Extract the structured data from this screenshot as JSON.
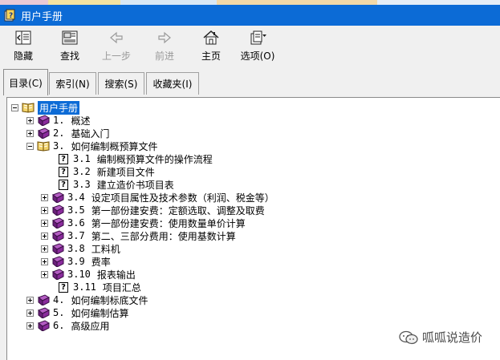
{
  "window": {
    "title": "用户手册"
  },
  "toolbar": {
    "buttons": [
      {
        "label": "隐藏",
        "icon": "hide-icon",
        "enabled": true
      },
      {
        "label": "查找",
        "icon": "find-icon",
        "enabled": true
      },
      {
        "label": "上一步",
        "icon": "back-arrow-icon",
        "enabled": false
      },
      {
        "label": "前进",
        "icon": "forward-arrow-icon",
        "enabled": false
      },
      {
        "label": "主页",
        "icon": "home-icon",
        "enabled": true
      },
      {
        "label": "选项(O)",
        "icon": "options-icon",
        "enabled": true
      }
    ]
  },
  "tabs": [
    {
      "label": "目录(C)",
      "active": true
    },
    {
      "label": "索引(N)",
      "active": false
    },
    {
      "label": "搜索(S)",
      "active": false
    },
    {
      "label": "收藏夹(I)",
      "active": false
    }
  ],
  "tree": {
    "root": {
      "label": "用户手册",
      "icon": "open-book-icon",
      "expanded": true,
      "selected": true
    },
    "items": [
      {
        "num": "1.",
        "label": "概述",
        "expander": "plus",
        "icon": "book-icon"
      },
      {
        "num": "2.",
        "label": "基础入门",
        "expander": "plus",
        "icon": "book-icon"
      },
      {
        "num": "3.",
        "label": "如何编制概预算文件",
        "expander": "minus",
        "icon": "open-book-icon",
        "children": [
          {
            "num": "3.1",
            "label": "编制概预算文件的操作流程",
            "expander": "none",
            "icon": "help-page-icon"
          },
          {
            "num": "3.2",
            "label": "新建项目文件",
            "expander": "none",
            "icon": "help-page-icon"
          },
          {
            "num": "3.3",
            "label": "建立造价书项目表",
            "expander": "none",
            "icon": "help-page-icon"
          },
          {
            "num": "3.4",
            "label": "设定项目属性及技术参数（利润、税金等）",
            "expander": "plus",
            "icon": "book-icon"
          },
          {
            "num": "3.5",
            "label": "第一部份建安费：定额选取、调整及取费",
            "expander": "plus",
            "icon": "book-icon"
          },
          {
            "num": "3.6",
            "label": "第一部份建安费：使用数量单价计算",
            "expander": "plus",
            "icon": "book-icon"
          },
          {
            "num": "3.7",
            "label": "第二、三部分费用：使用基数计算",
            "expander": "plus",
            "icon": "book-icon"
          },
          {
            "num": "3.8",
            "label": "工料机",
            "expander": "plus",
            "icon": "book-icon"
          },
          {
            "num": "3.9",
            "label": "费率",
            "expander": "plus",
            "icon": "book-icon"
          },
          {
            "num": "3.10",
            "label": "报表输出",
            "expander": "plus",
            "icon": "book-icon"
          },
          {
            "num": "3.11",
            "label": "项目汇总",
            "expander": "none",
            "icon": "help-page-icon"
          }
        ]
      },
      {
        "num": "4.",
        "label": "如何编制标底文件",
        "expander": "plus",
        "icon": "book-icon"
      },
      {
        "num": "5.",
        "label": "如何编制估算",
        "expander": "plus",
        "icon": "book-icon"
      },
      {
        "num": "6.",
        "label": "高级应用",
        "expander": "plus",
        "icon": "book-icon"
      }
    ]
  },
  "watermark": {
    "text": "呱呱说造价",
    "icon": "wechat-icon"
  },
  "colors": {
    "titlebar": "#0c6bd6",
    "selection": "#0c6bd6",
    "book": "#7b2a8c",
    "panel": "#ffffff",
    "chrome": "#f0f0f0"
  }
}
